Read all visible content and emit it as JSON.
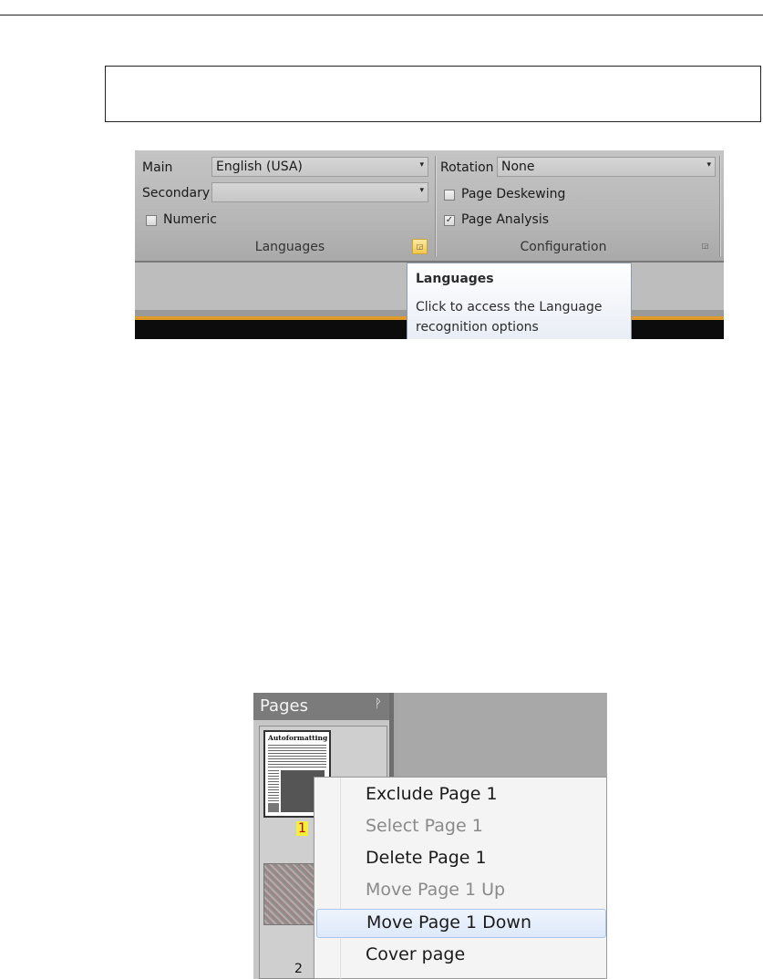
{
  "ribbon": {
    "languages_group": {
      "main_label": "Main",
      "main_value": "English (USA)",
      "secondary_label": "Secondary",
      "secondary_value": "",
      "numeric_label": "Numeric",
      "numeric_checked": false,
      "group_title": "Languages"
    },
    "configuration_group": {
      "rotation_label": "Rotation",
      "rotation_value": "None",
      "deskew_label": "Page Deskewing",
      "deskew_checked": false,
      "analysis_label": "Page Analysis",
      "analysis_checked": true,
      "group_title": "Configuration"
    },
    "tooltip": {
      "title": "Languages",
      "body": "Click to access the Language recognition options"
    },
    "dropdown_arrow": "▾",
    "check_mark": "✓",
    "launcher_glyph": "◲"
  },
  "pages_panel": {
    "title": "Pages",
    "pin_icon": "ᚹ",
    "thumb1_title": "Autoformatting",
    "page_numbers": [
      "1",
      "2"
    ],
    "selected_page": "1"
  },
  "context_menu": {
    "items": [
      {
        "label": "Exclude Page 1",
        "enabled": true
      },
      {
        "label": "Select Page 1",
        "enabled": false
      },
      {
        "label": "Delete Page 1",
        "enabled": true
      },
      {
        "label": "Move Page 1 Up",
        "enabled": false
      },
      {
        "label": "Move Page 1 Down",
        "enabled": true,
        "highlighted": true
      },
      {
        "label": "Cover page",
        "enabled": true
      }
    ]
  }
}
